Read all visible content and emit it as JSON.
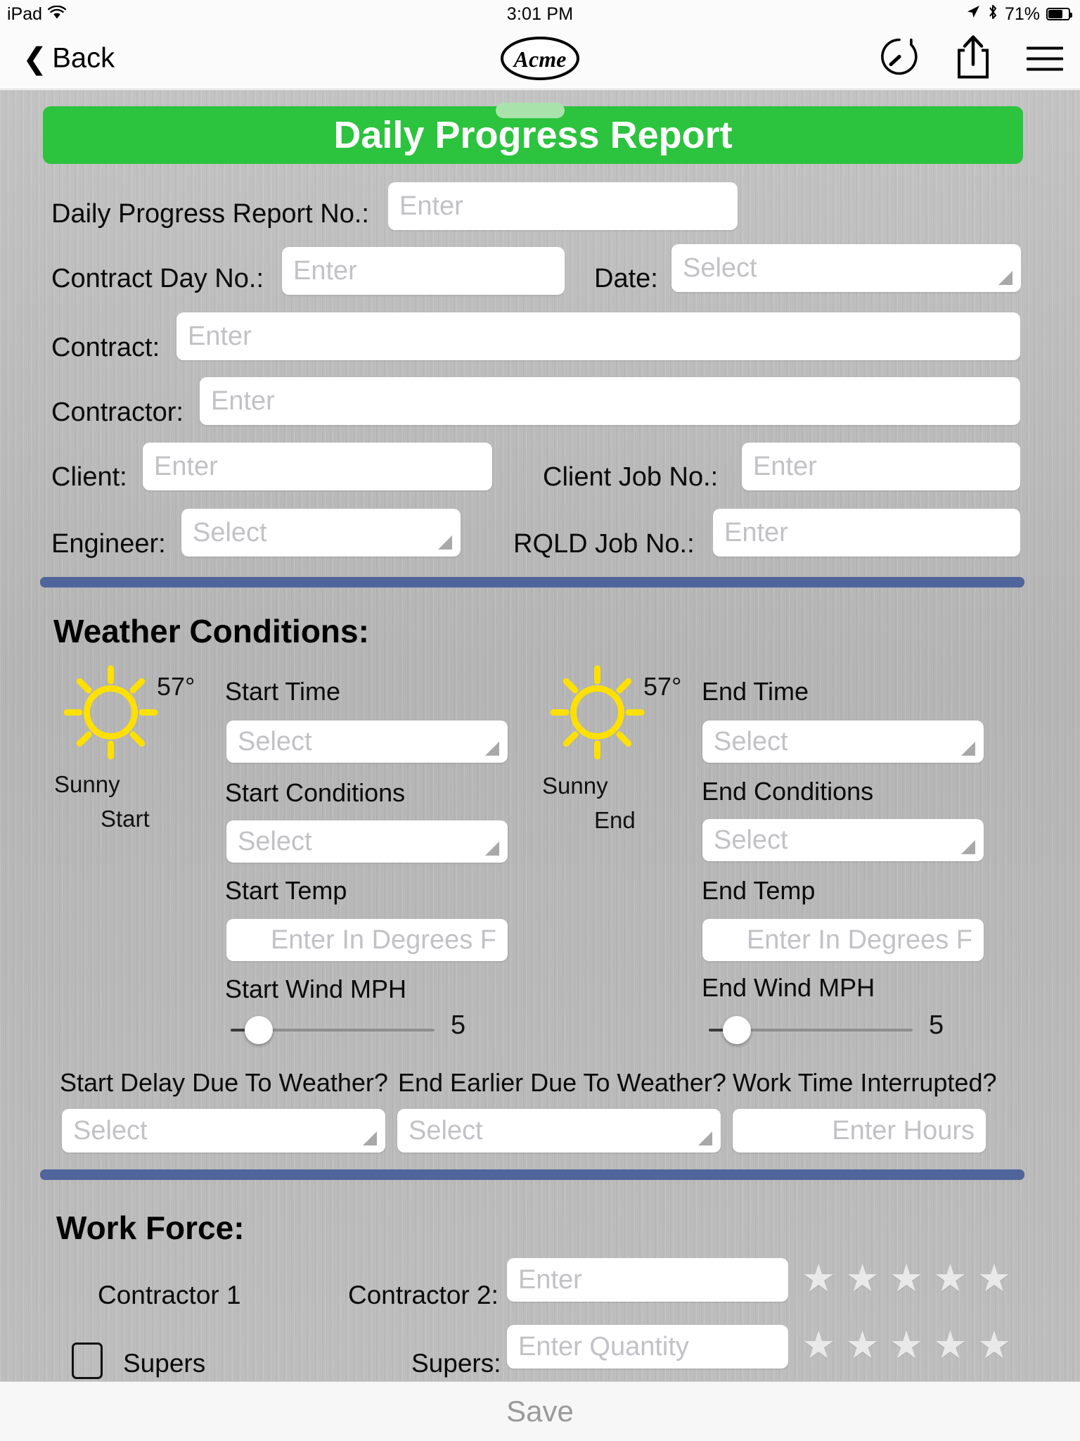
{
  "status_bar": {
    "device": "iPad",
    "wifi_icon": "wifi-icon",
    "time": "3:01 PM",
    "location_icon": "location-arrow-icon",
    "bluetooth_icon": "bluetooth-icon",
    "battery_percent": "71%"
  },
  "nav": {
    "back_label": "Back",
    "back_icon": "chevron-left-icon",
    "logo_text": "Acme",
    "history_icon": "clock-history-icon",
    "share_icon": "share-icon",
    "menu_icon": "hamburger-menu-icon"
  },
  "header": {
    "title": "Daily Progress Report"
  },
  "form": {
    "report_no_label": "Daily Progress Report No.:",
    "report_no_placeholder": "Enter",
    "contract_day_label": "Contract Day No.:",
    "contract_day_placeholder": "Enter",
    "date_label": "Date:",
    "date_placeholder": "Select",
    "contract_label": "Contract:",
    "contract_placeholder": "Enter",
    "contractor_label": "Contractor:",
    "contractor_placeholder": "Enter",
    "client_label": "Client:",
    "client_placeholder": "Enter",
    "client_job_label": "Client Job No.:",
    "client_job_placeholder": "Enter",
    "engineer_label": "Engineer:",
    "engineer_placeholder": "Select",
    "rqld_job_label": "RQLD Job No.:",
    "rqld_job_placeholder": "Enter"
  },
  "weather": {
    "heading": "Weather Conditions:",
    "start": {
      "icon": "sun-icon",
      "temp": "57°",
      "condition": "Sunny",
      "phase": "Start",
      "time_label": "Start Time",
      "time_placeholder": "Select",
      "conditions_label": "Start Conditions",
      "conditions_placeholder": "Select",
      "temp_label": "Start Temp",
      "temp_placeholder": "Enter In Degrees F",
      "wind_label": "Start Wind MPH",
      "wind_value": "5"
    },
    "end": {
      "icon": "sun-icon",
      "temp": "57°",
      "condition": "Sunny",
      "phase": "End",
      "time_label": "End Time",
      "time_placeholder": "Select",
      "conditions_label": "End Conditions",
      "conditions_placeholder": "Select",
      "temp_label": "End Temp",
      "temp_placeholder": "Enter In Degrees F",
      "wind_label": "End Wind MPH",
      "wind_value": "5"
    },
    "start_delay_label": "Start Delay Due To Weather?",
    "start_delay_placeholder": "Select",
    "end_earlier_label": "End Earlier Due To Weather?",
    "end_earlier_placeholder": "Select",
    "work_interrupt_label": "Work Time Interrupted?",
    "work_interrupt_placeholder": "Enter Hours"
  },
  "work_force": {
    "heading": "Work Force:",
    "contractor1_label": "Contractor 1",
    "contractor2_label": "Contractor 2:",
    "contractor2_placeholder": "Enter",
    "supers_checkbox_label": "Supers",
    "supers_label": "Supers:",
    "supers_placeholder": "Enter Quantity",
    "star_glyph": "★",
    "star_count": 5
  },
  "toolbar": {
    "save_label": "Save"
  },
  "colors": {
    "header_green": "#2cc33e",
    "divider_blue": "#4f659b",
    "sun_yellow": "#ffe000",
    "metal_gray": "#b6b6b6"
  }
}
